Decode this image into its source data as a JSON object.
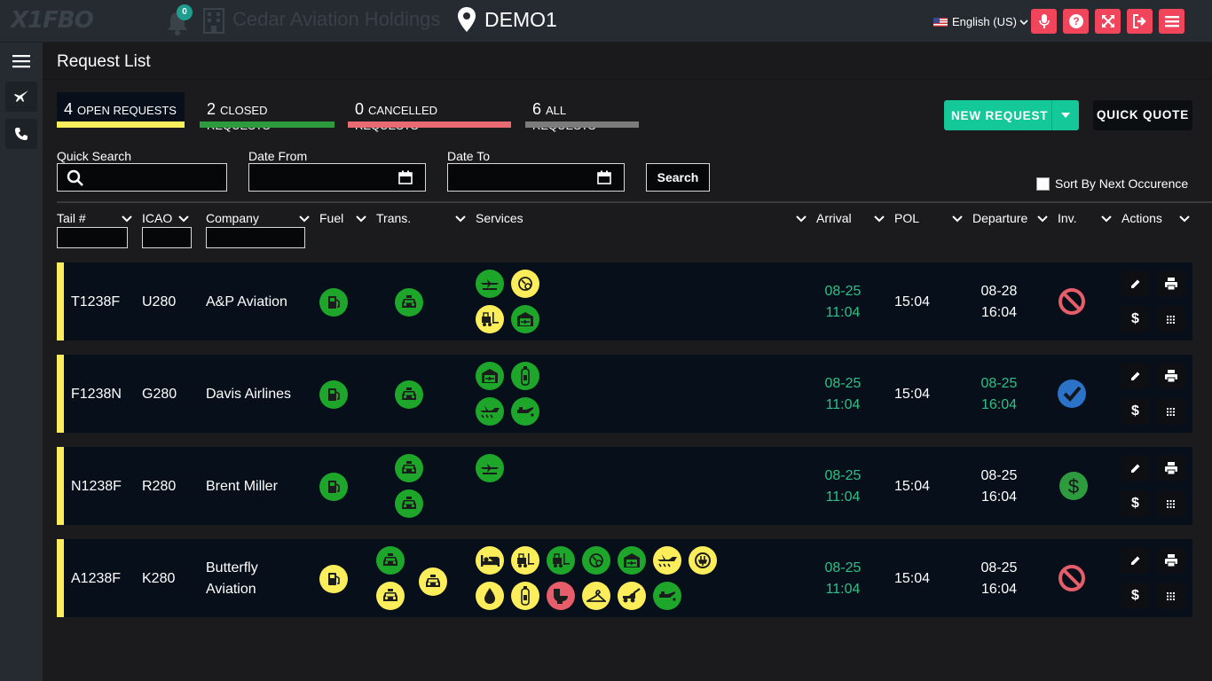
{
  "header": {
    "logo": "X1FBO",
    "notification_count": "0",
    "organization": "Cedar Aviation Holdings",
    "location": "DEMO1",
    "language": "English (US)"
  },
  "page": {
    "title": "Request List"
  },
  "tabs": [
    {
      "count": "4",
      "label": "OPEN REQUESTS",
      "color": "#fbee5c"
    },
    {
      "count": "2",
      "label": "CLOSED REQUESTS",
      "color": "#2e9b3e"
    },
    {
      "count": "0",
      "label": "CANCELLED REQUESTS",
      "color": "#e86a73"
    },
    {
      "count": "6",
      "label": "ALL REQUESTS",
      "color": "#7c7c7c"
    }
  ],
  "buttons": {
    "new_request": "NEW REQUEST",
    "quick_quote": "QUICK QUOTE",
    "search": "Search"
  },
  "filters": {
    "quick_search": "Quick Search",
    "date_from": "Date From",
    "date_to": "Date To",
    "sort_label": "Sort By Next Occurence"
  },
  "columns": [
    "Tail #",
    "ICAO",
    "Company",
    "Fuel",
    "Trans.",
    "Services",
    "Arrival",
    "POL",
    "Departure",
    "Inv.",
    "Actions"
  ],
  "rows": [
    {
      "tail": "T1238F",
      "icao": "U280",
      "company": "A&P Aviation",
      "fuel": "green",
      "transport": [
        "green"
      ],
      "services": [
        "green-plane",
        "yellow-gpu",
        "yellow-forklift",
        "green-hangar"
      ],
      "arrival_date": "08-25",
      "arrival_time": "11:04",
      "pol": "15:04",
      "departure_date": "08-28",
      "departure_time": "16:04",
      "departure_highlight": false,
      "invoice_status": "cancelled"
    },
    {
      "tail": "F1238N",
      "icao": "G280",
      "company": "Davis Airlines",
      "fuel": "green",
      "transport": [
        "green"
      ],
      "services": [
        "green-hangar",
        "green-oxygen",
        "green-deice",
        "green-oil"
      ],
      "arrival_date": "08-25",
      "arrival_time": "11:04",
      "pol": "15:04",
      "departure_date": "08-25",
      "departure_time": "16:04",
      "departure_highlight": true,
      "invoice_status": "paid"
    },
    {
      "tail": "N1238F",
      "icao": "R280",
      "company": "Brent Miller",
      "fuel": "green",
      "transport": [
        "green",
        "green"
      ],
      "services": [
        "green-plane"
      ],
      "arrival_date": "08-25",
      "arrival_time": "11:04",
      "pol": "15:04",
      "departure_date": "08-25",
      "departure_time": "16:04",
      "departure_highlight": false,
      "invoice_status": "billable"
    },
    {
      "tail": "A1238F",
      "icao": "K280",
      "company_line1": "Butterfly",
      "company_line2": "Aviation",
      "fuel": "yellow",
      "transport": [
        "green",
        "yellow",
        "yellow"
      ],
      "services": [
        "yellow-bed",
        "yellow-forklift",
        "green-forklift",
        "green-gpu",
        "green-hangar",
        "yellow-deice",
        "yellow-power",
        "yellow-water",
        "yellow-oxygen",
        "red-lav",
        "yellow-hanger",
        "yellow-tow",
        "green-oil"
      ],
      "arrival_date": "08-25",
      "arrival_time": "11:04",
      "pol": "15:04",
      "departure_date": "08-25",
      "departure_time": "16:04",
      "departure_highlight": false,
      "invoice_status": "cancelled"
    }
  ],
  "colors": {
    "accent_red": "#f0455a",
    "accent_green": "#15c89a",
    "time_green": "#2ec187",
    "row_bg": "#07101a",
    "pending_yellow": "#fbee5c"
  }
}
